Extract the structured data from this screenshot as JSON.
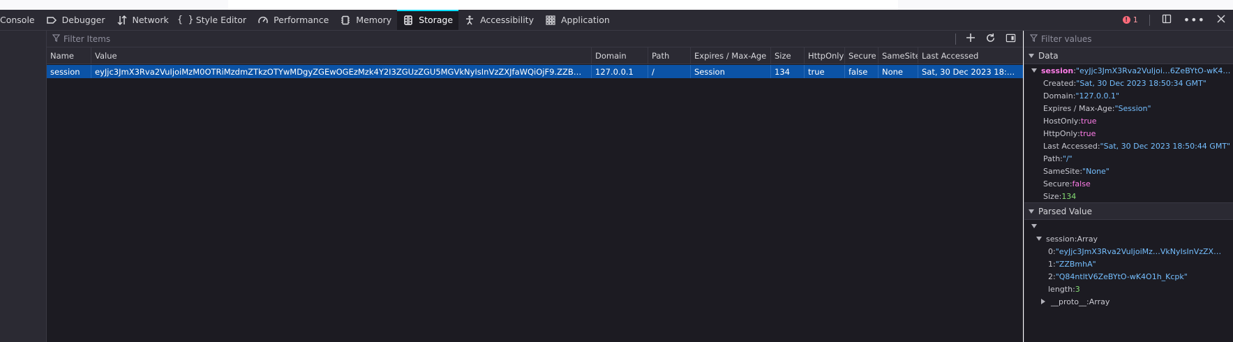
{
  "tabs": [
    {
      "label": "Console",
      "icon": "console-icon"
    },
    {
      "label": "Debugger",
      "icon": "debugger-icon"
    },
    {
      "label": "Network",
      "icon": "network-icon"
    },
    {
      "label": "Style Editor",
      "icon": "style-editor-icon"
    },
    {
      "label": "Performance",
      "icon": "performance-icon"
    },
    {
      "label": "Memory",
      "icon": "memory-icon"
    },
    {
      "label": "Storage",
      "icon": "storage-icon",
      "selected": true
    },
    {
      "label": "Accessibility",
      "icon": "accessibility-icon"
    },
    {
      "label": "Application",
      "icon": "application-icon"
    }
  ],
  "toolbar_right": {
    "error_count": "1"
  },
  "table": {
    "filter_placeholder": "Filter Items",
    "columns": [
      "Name",
      "Value",
      "Domain",
      "Path",
      "Expires / Max-Age",
      "Size",
      "HttpOnly",
      "Secure",
      "SameSite",
      "Last Accessed"
    ],
    "rows": [
      {
        "name": "session",
        "value": "eyJjc3JmX3Rva2VuIjoiMzM0OTRiMzdmZTkzOTYwMDgyZGEwOGEzMzk4Y2I3ZGUzZGU5MGVkNyIsInVzZXJfaWQiOjF9.ZZBmhA.Q84ntltV6ZeBYtO-wK4O…",
        "domain": "127.0.0.1",
        "path": "/",
        "expires": "Session",
        "size": "134",
        "httponly": "true",
        "secure": "false",
        "samesite": "None",
        "last_accessed": "Sat, 30 Dec 2023 18:50:44 …"
      }
    ]
  },
  "sidebar": {
    "filter_placeholder": "Filter values",
    "data_section": "Data",
    "cookie_key": "session",
    "cookie_value": "\"eyJjc3JmX3Rva2VuIjoi…6ZeBYtO-wK4O1h_Kcpk\"",
    "props": [
      {
        "key": "Created",
        "value": "\"Sat, 30 Dec 2023 18:50:34 GMT\"",
        "kind": "s"
      },
      {
        "key": "Domain",
        "value": "\"127.0.0.1\"",
        "kind": "s"
      },
      {
        "key": "Expires / Max-Age",
        "value": "\"Session\"",
        "kind": "s"
      },
      {
        "key": "HostOnly",
        "value": "true",
        "kind": "b"
      },
      {
        "key": "HttpOnly",
        "value": "true",
        "kind": "b"
      },
      {
        "key": "Last Accessed",
        "value": "\"Sat, 30 Dec 2023 18:50:44 GMT\"",
        "kind": "s"
      },
      {
        "key": "Path",
        "value": "\"/\"",
        "kind": "s"
      },
      {
        "key": "SameSite",
        "value": "\"None\"",
        "kind": "s"
      },
      {
        "key": "Secure",
        "value": "false",
        "kind": "b"
      },
      {
        "key": "Size",
        "value": "134",
        "kind": "n"
      }
    ],
    "parsed_section": "Parsed Value",
    "parsed_key": "session",
    "parsed_type": "Array",
    "items": [
      {
        "key": "0",
        "value": "\"eyJjc3JmX3Rva2VuIjoiMz…VkNyIsInVzZXJfaWQiOjF9\"",
        "kind": "s"
      },
      {
        "key": "1",
        "value": "\"ZZBmhA\"",
        "kind": "s"
      },
      {
        "key": "2",
        "value": "\"Q84ntltV6ZeBYtO-wK4O1h_Kcpk\"",
        "kind": "s"
      },
      {
        "key": "length",
        "value": "3",
        "kind": "n"
      }
    ],
    "proto_key": "__proto__",
    "proto_value": "Array"
  },
  "colors": {
    "accent": "#00ddff",
    "selected_row": "#0b53a6",
    "panel_bg": "#1c1b22",
    "toolbar_bg": "#2b2a33"
  }
}
